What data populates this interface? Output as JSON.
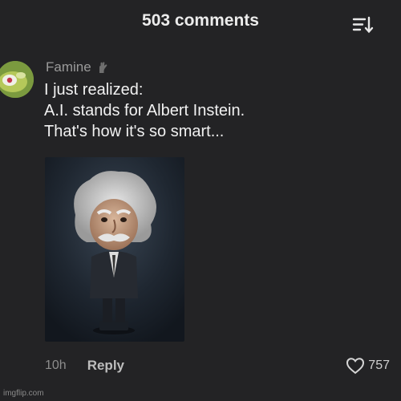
{
  "header": {
    "title": "503 comments",
    "sort_icon": "sort-descending-icon"
  },
  "comment": {
    "username": "Famine",
    "badge_icon": "hand-icon",
    "lines": [
      "I just realized:",
      "A.I. stands for Albert Instein.",
      "That's how it's so smart..."
    ],
    "time": "10h",
    "reply_label": "Reply",
    "likes": "757",
    "like_icon": "heart-icon"
  },
  "watermark": "imgflip.com",
  "colors": {
    "background": "#232325",
    "text": "#f1f1f1",
    "muted": "#8d8d8d"
  }
}
